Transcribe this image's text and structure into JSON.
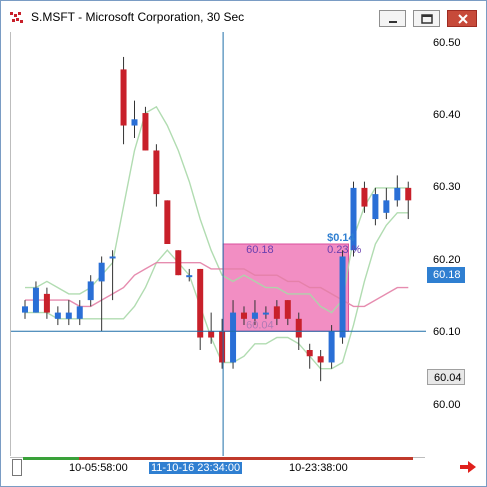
{
  "window": {
    "title": "S.MSFT - Microsoft Corporation, 30 Sec",
    "controls": [
      "minimize-icon",
      "restore-icon",
      "close-icon"
    ]
  },
  "y_axis": {
    "ticks": [
      "60.50",
      "60.40",
      "60.30",
      "60.20",
      "60.10",
      "60.00"
    ]
  },
  "price_tags": {
    "current": "60.18",
    "crosshair": "60.04"
  },
  "x_axis": {
    "ticks": [
      "10-05:58:00",
      "11-10-16 23:34:00",
      "10-23:38:00"
    ],
    "highlighted_index": 1
  },
  "measure_box": {
    "high_label": "60.18",
    "low_label": "60.04",
    "change_label": "$0.14",
    "percent_label": "0.23 %"
  },
  "colors": {
    "up": "#2a6fd6",
    "down": "#c8202a",
    "measure_fill": "#f07ab8",
    "crosshair": "#1f6fa8",
    "band": "#a9d8a9",
    "ma": "#e37fa6"
  },
  "chart_data": {
    "type": "candlestick",
    "ylim": [
      59.84,
      60.52
    ],
    "yticks": [
      60.0,
      60.1,
      60.2,
      60.3,
      60.4,
      60.5
    ],
    "candles": [
      {
        "o": 60.07,
        "c": 60.08,
        "h": 60.09,
        "l": 60.06
      },
      {
        "o": 60.07,
        "c": 60.11,
        "h": 60.12,
        "l": 60.07
      },
      {
        "o": 60.1,
        "c": 60.07,
        "h": 60.11,
        "l": 60.06
      },
      {
        "o": 60.06,
        "c": 60.07,
        "h": 60.08,
        "l": 60.05
      },
      {
        "o": 60.06,
        "c": 60.07,
        "h": 60.09,
        "l": 60.05
      },
      {
        "o": 60.06,
        "c": 60.08,
        "h": 60.09,
        "l": 60.05
      },
      {
        "o": 60.09,
        "c": 60.12,
        "h": 60.13,
        "l": 60.08
      },
      {
        "o": 60.12,
        "c": 60.15,
        "h": 60.16,
        "l": 60.04
      },
      {
        "o": 60.16,
        "c": 60.16,
        "h": 60.17,
        "l": 60.09
      },
      {
        "o": 60.46,
        "c": 60.37,
        "h": 60.48,
        "l": 60.34
      },
      {
        "o": 60.37,
        "c": 60.38,
        "h": 60.41,
        "l": 60.35
      },
      {
        "o": 60.39,
        "c": 60.33,
        "h": 60.4,
        "l": 60.33
      },
      {
        "o": 60.33,
        "c": 60.26,
        "h": 60.34,
        "l": 60.24
      },
      {
        "o": 60.25,
        "c": 60.18,
        "h": 60.25,
        "l": 60.18
      },
      {
        "o": 60.17,
        "c": 60.13,
        "h": 60.17,
        "l": 60.13
      },
      {
        "o": 60.13,
        "c": 60.13,
        "h": 60.14,
        "l": 60.12
      },
      {
        "o": 60.14,
        "c": 60.03,
        "h": 60.14,
        "l": 60.01
      },
      {
        "o": 60.04,
        "c": 60.03,
        "h": 60.07,
        "l": 60.02
      },
      {
        "o": 60.04,
        "c": 59.99,
        "h": 60.06,
        "l": 59.98
      },
      {
        "o": 59.99,
        "c": 60.07,
        "h": 60.09,
        "l": 59.98
      },
      {
        "o": 60.07,
        "c": 60.06,
        "h": 60.08,
        "l": 60.05
      },
      {
        "o": 60.06,
        "c": 60.07,
        "h": 60.09,
        "l": 60.05
      },
      {
        "o": 60.07,
        "c": 60.07,
        "h": 60.08,
        "l": 60.06
      },
      {
        "o": 60.08,
        "c": 60.06,
        "h": 60.09,
        "l": 60.05
      },
      {
        "o": 60.09,
        "c": 60.06,
        "h": 60.09,
        "l": 60.05
      },
      {
        "o": 60.06,
        "c": 60.03,
        "h": 60.07,
        "l": 60.01
      },
      {
        "o": 60.01,
        "c": 60.0,
        "h": 60.02,
        "l": 59.98
      },
      {
        "o": 60.0,
        "c": 59.99,
        "h": 60.01,
        "l": 59.96
      },
      {
        "o": 59.99,
        "c": 60.04,
        "h": 60.05,
        "l": 59.98
      },
      {
        "o": 60.03,
        "c": 60.16,
        "h": 60.17,
        "l": 60.02
      },
      {
        "o": 60.17,
        "c": 60.27,
        "h": 60.28,
        "l": 60.16
      },
      {
        "o": 60.27,
        "c": 60.24,
        "h": 60.28,
        "l": 60.23
      },
      {
        "o": 60.22,
        "c": 60.26,
        "h": 60.27,
        "l": 60.21
      },
      {
        "o": 60.23,
        "c": 60.25,
        "h": 60.27,
        "l": 60.22
      },
      {
        "o": 60.25,
        "c": 60.27,
        "h": 60.29,
        "l": 60.24
      },
      {
        "o": 60.27,
        "c": 60.25,
        "h": 60.28,
        "l": 60.22
      }
    ],
    "band_upper": [
      60.11,
      60.11,
      60.12,
      60.11,
      60.1,
      60.1,
      60.11,
      60.13,
      60.15,
      60.24,
      60.33,
      60.39,
      60.4,
      60.37,
      60.33,
      60.28,
      60.22,
      60.17,
      60.13,
      60.12,
      60.13,
      60.12,
      60.11,
      60.11,
      60.1,
      60.1,
      60.1,
      60.08,
      60.07,
      60.09,
      60.19,
      60.24,
      60.27,
      60.27,
      60.27,
      60.27
    ],
    "band_lower": [
      60.07,
      60.07,
      60.07,
      60.06,
      60.06,
      60.06,
      60.06,
      60.06,
      60.06,
      60.06,
      60.08,
      60.11,
      60.15,
      60.17,
      60.15,
      60.13,
      60.08,
      60.03,
      59.99,
      59.99,
      60.0,
      60.02,
      60.02,
      60.03,
      60.03,
      60.02,
      60.0,
      59.98,
      59.98,
      59.99,
      60.05,
      60.12,
      60.18,
      60.21,
      60.23,
      60.23
    ],
    "ma": [
      60.09,
      60.09,
      60.09,
      60.09,
      60.09,
      60.08,
      60.08,
      60.09,
      60.1,
      60.11,
      60.13,
      60.14,
      60.15,
      60.15,
      60.15,
      60.15,
      60.15,
      60.14,
      60.14,
      60.14,
      60.14,
      60.13,
      60.13,
      60.13,
      60.12,
      60.12,
      60.11,
      60.11,
      60.1,
      60.09,
      60.08,
      60.08,
      60.09,
      60.1,
      60.11,
      60.11
    ],
    "crosshair": {
      "candle_index": 18,
      "price": 60.04
    },
    "measure_range": {
      "from_index": 18,
      "to_index": 29,
      "high": 60.18,
      "low": 60.04
    }
  }
}
